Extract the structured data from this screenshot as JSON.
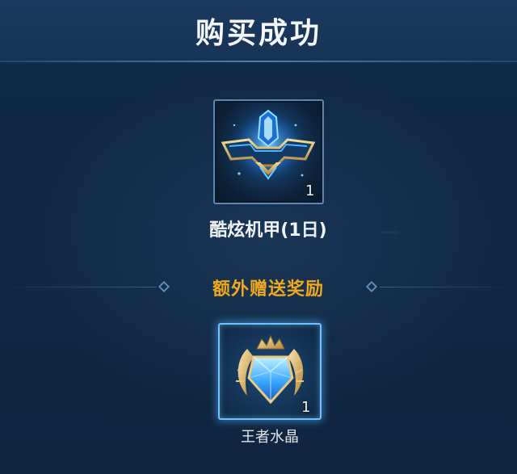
{
  "header": {
    "title": "购买成功"
  },
  "purchased_item": {
    "name": "酷炫机甲(1日)",
    "count": "1",
    "icon": "mecha-emblem-icon"
  },
  "bonus": {
    "title": "额外赠送奖励",
    "reward": {
      "name": "王者水晶",
      "count": "1",
      "icon": "king-crystal-icon"
    }
  },
  "colors": {
    "background": "#10263f",
    "title_text": "#f3f6fa",
    "bonus_title": "#f0a81d",
    "card_border": "#5b86ad",
    "reward_glow": "#6ec2ff"
  }
}
